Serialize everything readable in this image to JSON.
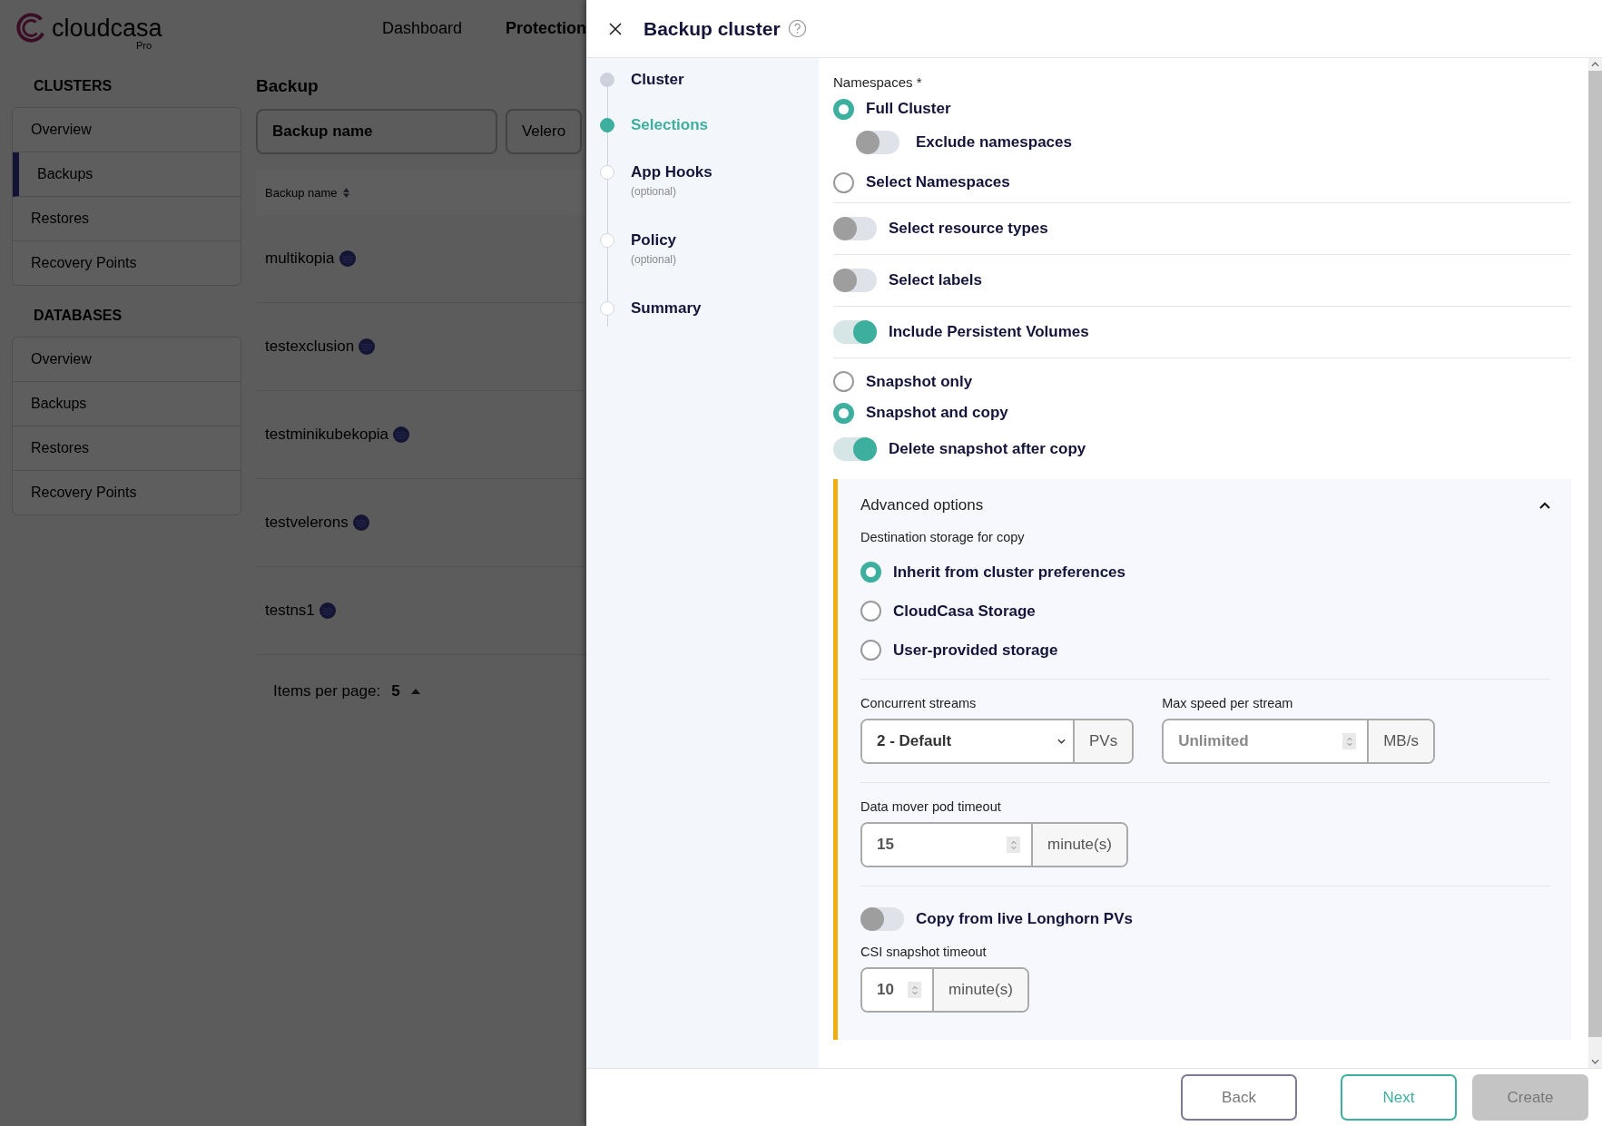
{
  "app": {
    "logo_text": "cloudcasa",
    "logo_badge": "Pro",
    "nav": [
      {
        "label": "Dashboard",
        "selected": false
      },
      {
        "label": "Protection",
        "selected": true
      }
    ]
  },
  "sidebar": {
    "sections": [
      {
        "heading": "CLUSTERS",
        "items": [
          {
            "label": "Overview",
            "selected": false
          },
          {
            "label": "Backups",
            "selected": true
          },
          {
            "label": "Restores",
            "selected": false
          },
          {
            "label": "Recovery Points",
            "selected": false
          }
        ]
      },
      {
        "heading": "DATABASES",
        "items": [
          {
            "label": "Overview",
            "selected": false
          },
          {
            "label": "Backups",
            "selected": false
          },
          {
            "label": "Restores",
            "selected": false
          },
          {
            "label": "Recovery Points",
            "selected": false
          }
        ]
      }
    ]
  },
  "page": {
    "title": "Backup",
    "search": {
      "placeholder": "Backup name"
    },
    "filter_button": "Velero",
    "table": {
      "columns": [
        "Backup name"
      ],
      "rows": [
        {
          "name": "multikopia"
        },
        {
          "name": "testexclusion"
        },
        {
          "name": "testminikubekopia"
        },
        {
          "name": "testvelerons"
        },
        {
          "name": "testns1"
        }
      ]
    },
    "pagination": {
      "label": "Items per page:",
      "value": "5"
    }
  },
  "dialog": {
    "title": "Backup cluster",
    "steps": [
      {
        "label": "Cluster",
        "completed": true,
        "selected": false
      },
      {
        "label": "Selections",
        "completed": false,
        "selected": true
      },
      {
        "label": "App Hooks",
        "hint": "(optional)",
        "completed": false,
        "selected": false
      },
      {
        "label": "Policy",
        "hint": "(optional)",
        "completed": false,
        "selected": false
      },
      {
        "label": "Summary",
        "completed": false,
        "selected": false
      }
    ],
    "namespaces": {
      "label": "Namespaces *",
      "options": [
        {
          "label": "Full Cluster",
          "selected": true,
          "sub_toggle": {
            "label": "Exclude namespaces",
            "on": false
          }
        },
        {
          "label": "Select Namespaces",
          "selected": false
        }
      ]
    },
    "toggles": [
      {
        "label": "Select resource types",
        "on": false
      },
      {
        "label": "Select labels",
        "on": false
      },
      {
        "label": "Include Persistent Volumes",
        "on": true
      }
    ],
    "snapshot_mode": {
      "options": [
        {
          "label": "Snapshot only",
          "selected": false
        },
        {
          "label": "Snapshot and copy",
          "selected": true
        }
      ],
      "delete_after_copy": {
        "label": "Delete snapshot after copy",
        "on": true
      }
    },
    "advanced": {
      "title": "Advanced options",
      "expanded": true,
      "destination": {
        "label": "Destination storage for copy",
        "options": [
          {
            "label": "Inherit from cluster preferences",
            "selected": true
          },
          {
            "label": "CloudCasa Storage",
            "selected": false
          },
          {
            "label": "User-provided storage",
            "selected": false
          }
        ]
      },
      "concurrent_streams": {
        "label": "Concurrent streams",
        "value": "2 - Default",
        "unit": "PVs"
      },
      "max_speed": {
        "label": "Max speed per stream",
        "placeholder": "Unlimited",
        "unit": "MB/s"
      },
      "data_mover_timeout": {
        "label": "Data mover pod timeout",
        "value": "15",
        "unit": "minute(s)"
      },
      "longhorn": {
        "label": "Copy from live Longhorn PVs",
        "on": false
      },
      "csi_timeout": {
        "label": "CSI snapshot timeout",
        "value": "10",
        "unit": "minute(s)"
      }
    },
    "buttons": [
      {
        "label": "Back",
        "kind": "back",
        "disabled": false
      },
      {
        "label": "Next",
        "kind": "next",
        "disabled": false
      },
      {
        "label": "Create",
        "kind": "create",
        "disabled": true
      }
    ]
  }
}
